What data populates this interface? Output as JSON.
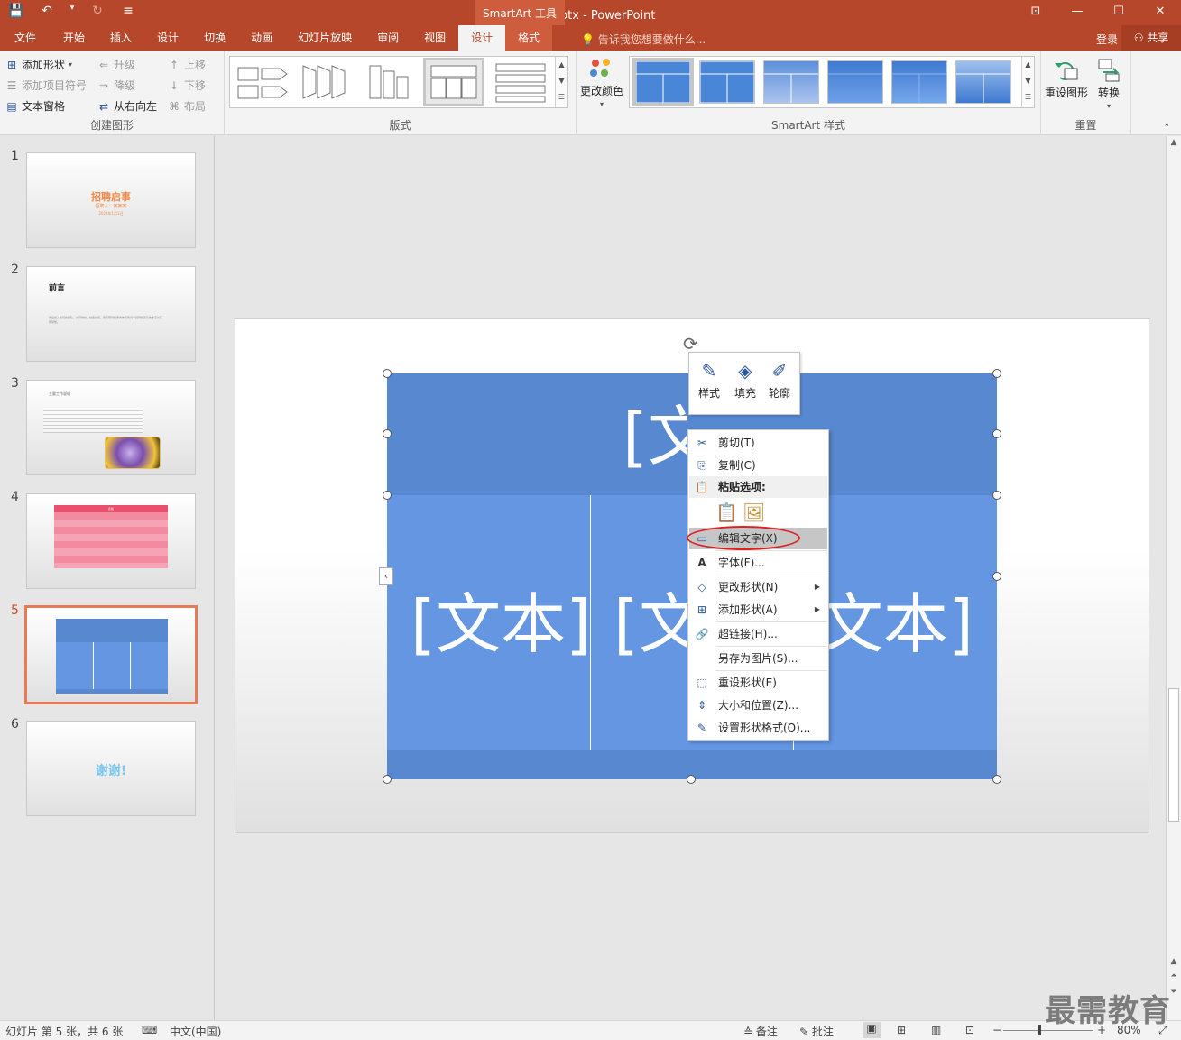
{
  "window": {
    "title": "谢谢.pptx - PowerPoint",
    "tools_band": "SmartArt 工具"
  },
  "qat": {
    "save": "💾",
    "undo": "↶",
    "undo_arrow": "▾",
    "redo": "↻",
    "customize": "≡"
  },
  "window_controls": {
    "restore_ribbon": "⊡",
    "minimize": "—",
    "maximize": "☐",
    "close": "✕"
  },
  "tabs": [
    {
      "label": "文件"
    },
    {
      "label": "开始"
    },
    {
      "label": "插入"
    },
    {
      "label": "设计"
    },
    {
      "label": "切换"
    },
    {
      "label": "动画"
    },
    {
      "label": "幻灯片放映"
    },
    {
      "label": "审阅"
    },
    {
      "label": "视图"
    },
    {
      "label": "设计"
    },
    {
      "label": "格式"
    }
  ],
  "tellme": "告诉我您想要做什么...",
  "account": {
    "login": "登录",
    "share": "共享"
  },
  "ribbon": {
    "create": {
      "add_shape": "添加形状",
      "add_bullet": "添加项目符号",
      "text_pane": "文本窗格",
      "promote": "升级",
      "demote": "降级",
      "rtl": "从右向左",
      "move_up": "上移",
      "move_down": "下移",
      "layout": "布局",
      "label": "创建图形"
    },
    "layouts": {
      "label": "版式"
    },
    "styles": {
      "change_color": "更改颜色",
      "label": "SmartArt 样式"
    },
    "reset": {
      "reset_graphic": "重设图形",
      "convert": "转换",
      "label": "重置"
    }
  },
  "thumbnails": [
    {
      "num": "1",
      "title": "招聘启事",
      "sub": "招聘人：某某某",
      "date": "2021年1月1日"
    },
    {
      "num": "2",
      "title": "前言",
      "body": "欢迎加入我们的团队，共同成长，创造价值。我们期待优秀的你与我们一起开创美好的未来并实现梦想。"
    },
    {
      "num": "3",
      "body": "主要工作说明"
    },
    {
      "num": "4",
      "header": "表格"
    },
    {
      "num": "5"
    },
    {
      "num": "6",
      "title": "谢谢!"
    }
  ],
  "smartart": {
    "top_text": "[文本]",
    "col1": "[文本]",
    "col2": "[文本]",
    "col3": "[文本]"
  },
  "mini_toolbar": [
    {
      "label": "样式",
      "icon": "✎"
    },
    {
      "label": "填充",
      "icon": "◈"
    },
    {
      "label": "轮廓",
      "icon": "✐"
    }
  ],
  "context_menu": {
    "cut": "剪切(T)",
    "copy": "复制(C)",
    "paste_header": "粘贴选项:",
    "edit_text": "编辑文字(X)",
    "font": "字体(F)...",
    "change_shape": "更改形状(N)",
    "add_shape": "添加形状(A)",
    "hyperlink": "超链接(H)...",
    "save_as_picture": "另存为图片(S)...",
    "reset_shape": "重设形状(E)",
    "size_position": "大小和位置(Z)...",
    "format_shape": "设置形状格式(O)..."
  },
  "statusbar": {
    "slide_info": "幻灯片 第 5 张，共 6 张",
    "language": "中文(中国)",
    "notes": "备注",
    "comments": "批注",
    "zoom": "80%",
    "minus": "−",
    "plus": "+"
  },
  "watermark": "最需教育"
}
